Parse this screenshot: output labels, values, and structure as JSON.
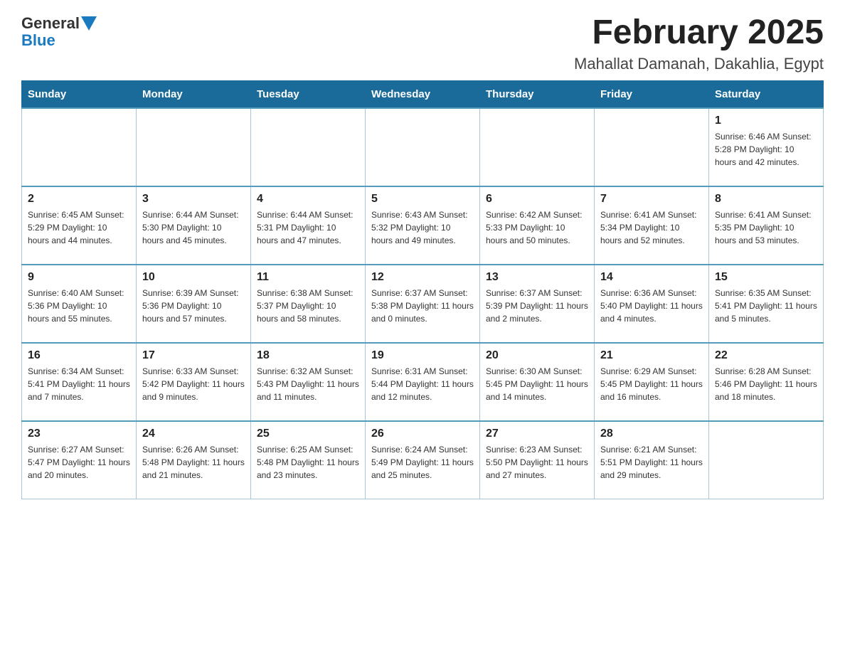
{
  "header": {
    "logo_general": "General",
    "logo_blue": "Blue",
    "month_title": "February 2025",
    "location": "Mahallat Damanah, Dakahlia, Egypt"
  },
  "days_of_week": [
    "Sunday",
    "Monday",
    "Tuesday",
    "Wednesday",
    "Thursday",
    "Friday",
    "Saturday"
  ],
  "weeks": [
    [
      {
        "day": "",
        "info": ""
      },
      {
        "day": "",
        "info": ""
      },
      {
        "day": "",
        "info": ""
      },
      {
        "day": "",
        "info": ""
      },
      {
        "day": "",
        "info": ""
      },
      {
        "day": "",
        "info": ""
      },
      {
        "day": "1",
        "info": "Sunrise: 6:46 AM\nSunset: 5:28 PM\nDaylight: 10 hours and 42 minutes."
      }
    ],
    [
      {
        "day": "2",
        "info": "Sunrise: 6:45 AM\nSunset: 5:29 PM\nDaylight: 10 hours and 44 minutes."
      },
      {
        "day": "3",
        "info": "Sunrise: 6:44 AM\nSunset: 5:30 PM\nDaylight: 10 hours and 45 minutes."
      },
      {
        "day": "4",
        "info": "Sunrise: 6:44 AM\nSunset: 5:31 PM\nDaylight: 10 hours and 47 minutes."
      },
      {
        "day": "5",
        "info": "Sunrise: 6:43 AM\nSunset: 5:32 PM\nDaylight: 10 hours and 49 minutes."
      },
      {
        "day": "6",
        "info": "Sunrise: 6:42 AM\nSunset: 5:33 PM\nDaylight: 10 hours and 50 minutes."
      },
      {
        "day": "7",
        "info": "Sunrise: 6:41 AM\nSunset: 5:34 PM\nDaylight: 10 hours and 52 minutes."
      },
      {
        "day": "8",
        "info": "Sunrise: 6:41 AM\nSunset: 5:35 PM\nDaylight: 10 hours and 53 minutes."
      }
    ],
    [
      {
        "day": "9",
        "info": "Sunrise: 6:40 AM\nSunset: 5:36 PM\nDaylight: 10 hours and 55 minutes."
      },
      {
        "day": "10",
        "info": "Sunrise: 6:39 AM\nSunset: 5:36 PM\nDaylight: 10 hours and 57 minutes."
      },
      {
        "day": "11",
        "info": "Sunrise: 6:38 AM\nSunset: 5:37 PM\nDaylight: 10 hours and 58 minutes."
      },
      {
        "day": "12",
        "info": "Sunrise: 6:37 AM\nSunset: 5:38 PM\nDaylight: 11 hours and 0 minutes."
      },
      {
        "day": "13",
        "info": "Sunrise: 6:37 AM\nSunset: 5:39 PM\nDaylight: 11 hours and 2 minutes."
      },
      {
        "day": "14",
        "info": "Sunrise: 6:36 AM\nSunset: 5:40 PM\nDaylight: 11 hours and 4 minutes."
      },
      {
        "day": "15",
        "info": "Sunrise: 6:35 AM\nSunset: 5:41 PM\nDaylight: 11 hours and 5 minutes."
      }
    ],
    [
      {
        "day": "16",
        "info": "Sunrise: 6:34 AM\nSunset: 5:41 PM\nDaylight: 11 hours and 7 minutes."
      },
      {
        "day": "17",
        "info": "Sunrise: 6:33 AM\nSunset: 5:42 PM\nDaylight: 11 hours and 9 minutes."
      },
      {
        "day": "18",
        "info": "Sunrise: 6:32 AM\nSunset: 5:43 PM\nDaylight: 11 hours and 11 minutes."
      },
      {
        "day": "19",
        "info": "Sunrise: 6:31 AM\nSunset: 5:44 PM\nDaylight: 11 hours and 12 minutes."
      },
      {
        "day": "20",
        "info": "Sunrise: 6:30 AM\nSunset: 5:45 PM\nDaylight: 11 hours and 14 minutes."
      },
      {
        "day": "21",
        "info": "Sunrise: 6:29 AM\nSunset: 5:45 PM\nDaylight: 11 hours and 16 minutes."
      },
      {
        "day": "22",
        "info": "Sunrise: 6:28 AM\nSunset: 5:46 PM\nDaylight: 11 hours and 18 minutes."
      }
    ],
    [
      {
        "day": "23",
        "info": "Sunrise: 6:27 AM\nSunset: 5:47 PM\nDaylight: 11 hours and 20 minutes."
      },
      {
        "day": "24",
        "info": "Sunrise: 6:26 AM\nSunset: 5:48 PM\nDaylight: 11 hours and 21 minutes."
      },
      {
        "day": "25",
        "info": "Sunrise: 6:25 AM\nSunset: 5:48 PM\nDaylight: 11 hours and 23 minutes."
      },
      {
        "day": "26",
        "info": "Sunrise: 6:24 AM\nSunset: 5:49 PM\nDaylight: 11 hours and 25 minutes."
      },
      {
        "day": "27",
        "info": "Sunrise: 6:23 AM\nSunset: 5:50 PM\nDaylight: 11 hours and 27 minutes."
      },
      {
        "day": "28",
        "info": "Sunrise: 6:21 AM\nSunset: 5:51 PM\nDaylight: 11 hours and 29 minutes."
      },
      {
        "day": "",
        "info": ""
      }
    ]
  ]
}
